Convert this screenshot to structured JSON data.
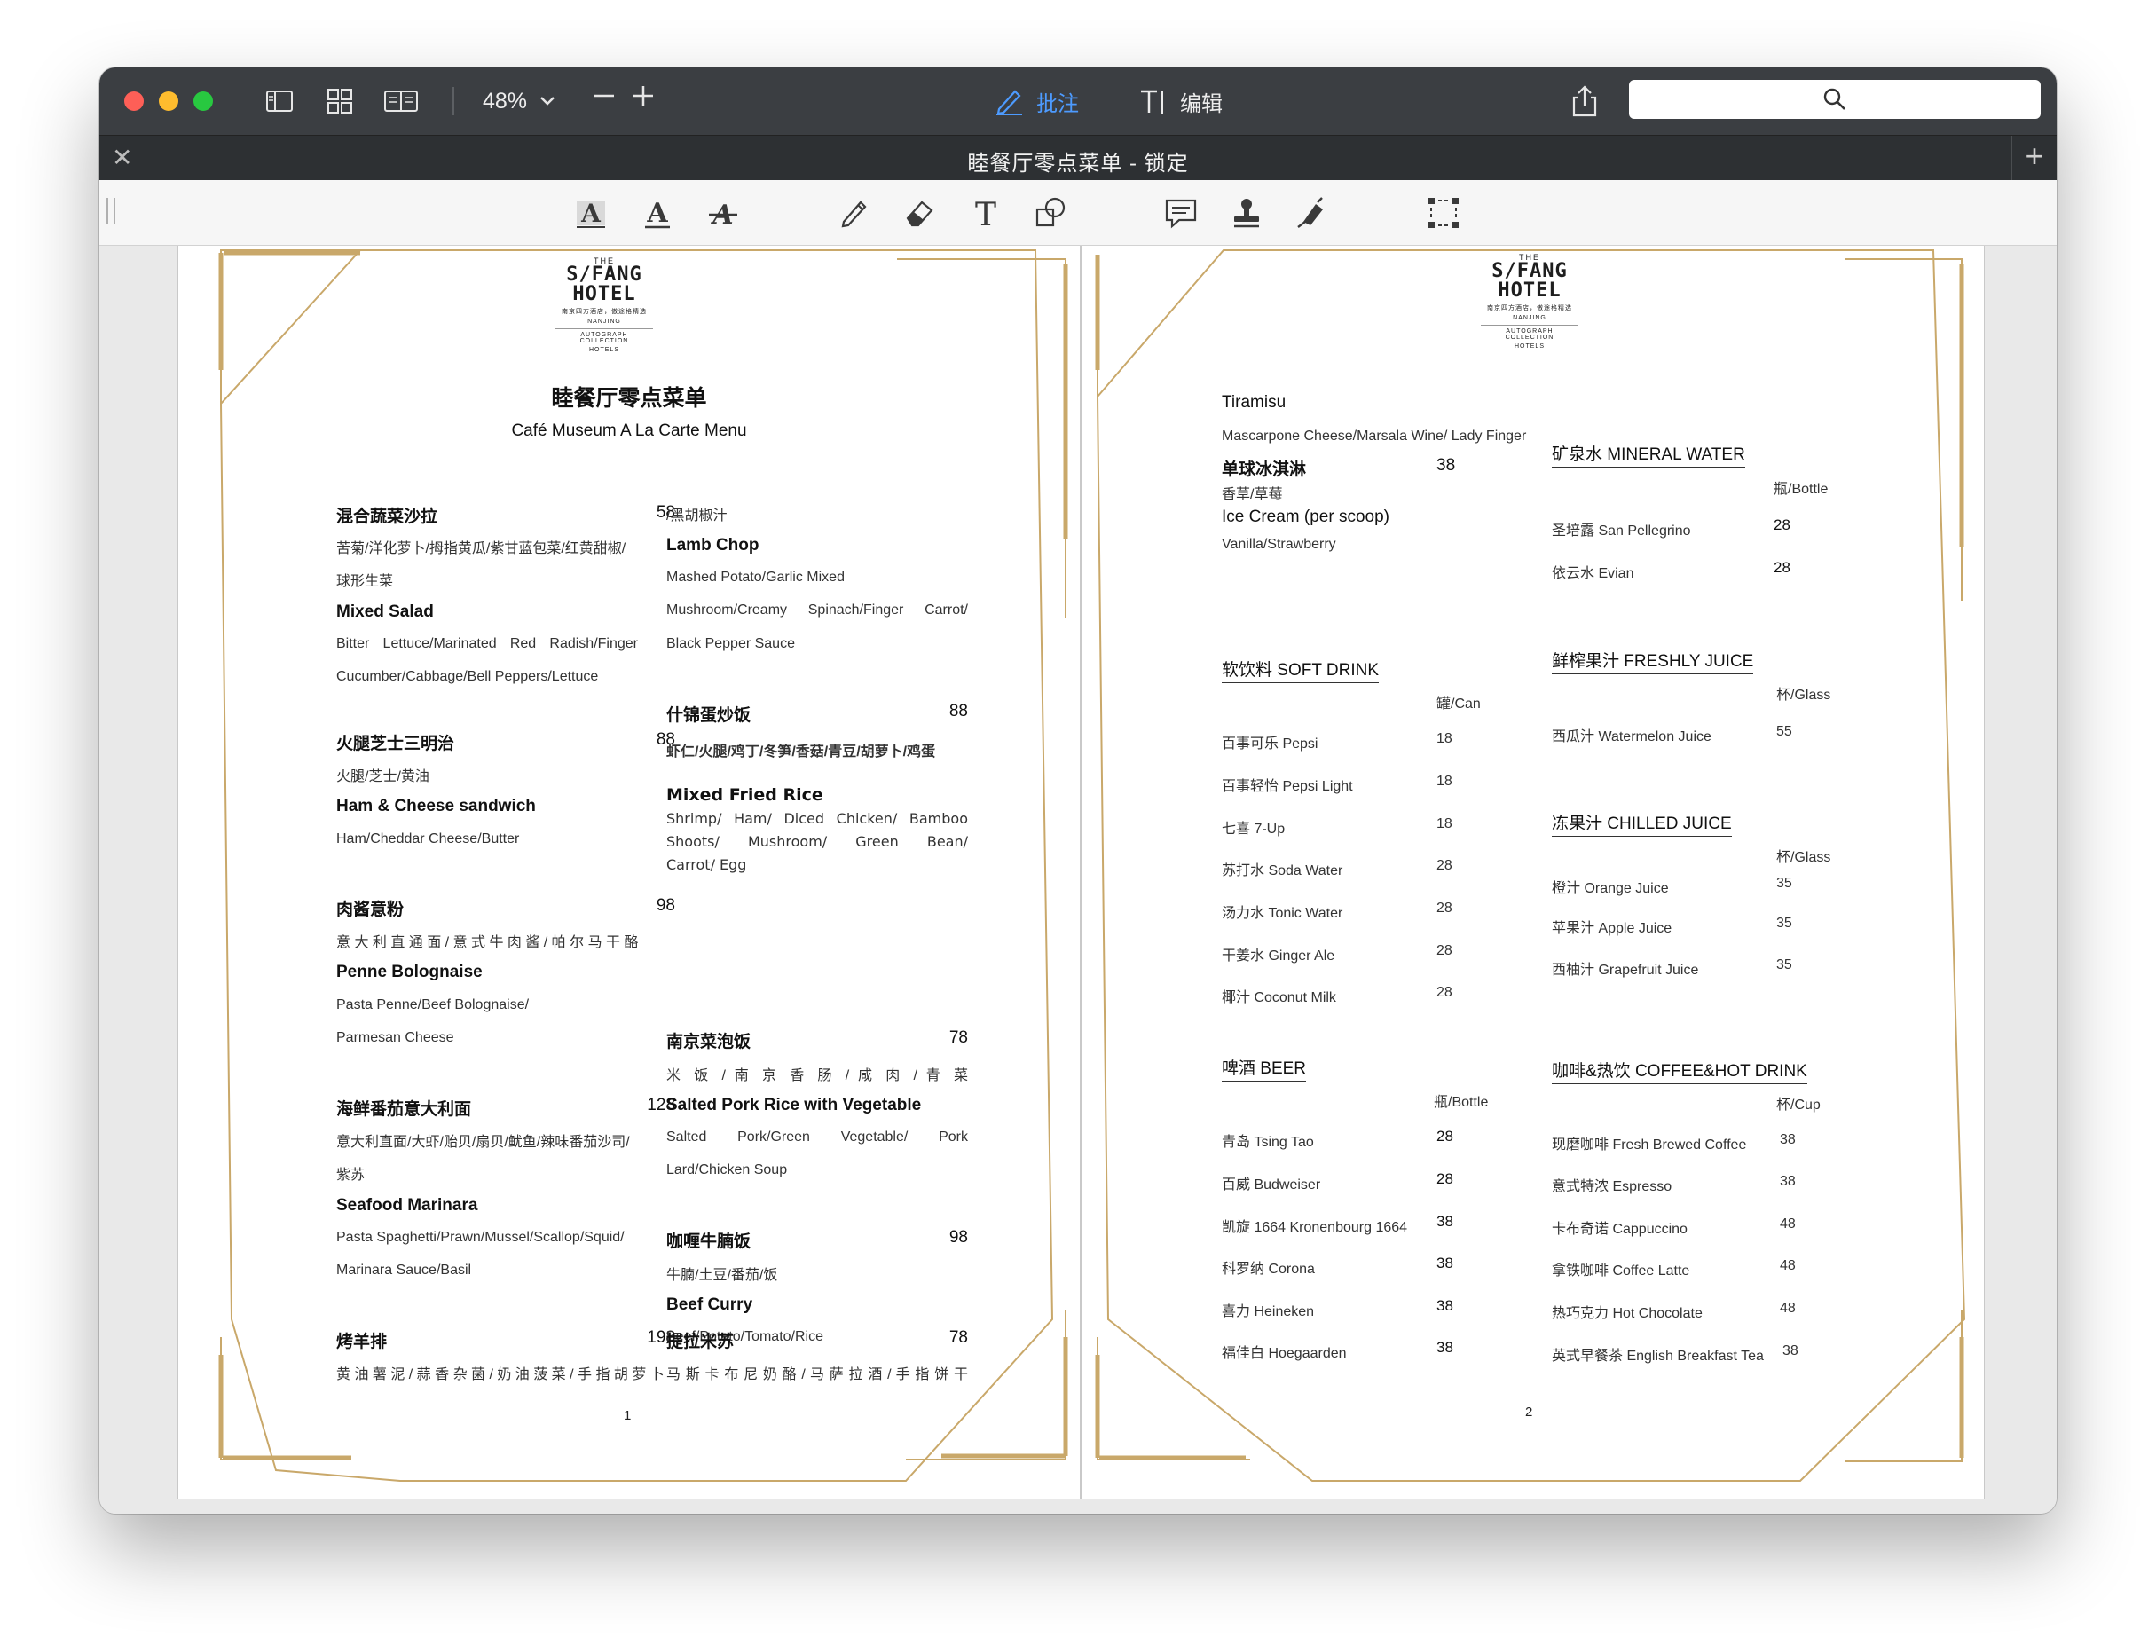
{
  "toolbar": {
    "zoom": "48%",
    "annotate_label": "批注",
    "edit_label": "编辑",
    "search_placeholder": ""
  },
  "tab": {
    "title": "睦餐厅零点菜单 - 锁定"
  },
  "logo": {
    "the": "THE",
    "line1": "S/FANG",
    "line2": "HOTEL",
    "sub1": "南京四方酒店，傲途格精选",
    "sub2": "NANJING",
    "collection": "AUTOGRAPH COLLECTION",
    "hotels": "HOTELS"
  },
  "page1": {
    "title_zh": "睦餐厅零点菜单",
    "title_en": "Café Museum A La Carte Menu",
    "page_num": "1",
    "items": {
      "salad": {
        "zh": "混合蔬菜沙拉",
        "price": "58",
        "desc_zh_1": "苦菊/洋化萝卜/拇指黄瓜/紫甘蓝包菜/红黄甜椒/",
        "desc_zh_2": "球形生菜",
        "en": "Mixed Salad",
        "desc_en_1": "Bitter  Lettuce/Marinated  Red  Radish/Finger",
        "desc_en_2": "Cucumber/Cabbage/Bell Peppers/Lettuce"
      },
      "ham": {
        "zh": "火腿芝士三明治",
        "price": "88",
        "desc_zh": "火腿/芝士/黄油",
        "en": "Ham & Cheese sandwich",
        "desc_en": "Ham/Cheddar Cheese/Butter"
      },
      "penne": {
        "zh": "肉酱意粉",
        "price": "98",
        "desc_zh": "意 大 利 直 通 面 / 意 式 牛 肉 酱 / 帕 尔 马 干 酪",
        "en": "Penne Bolognaise",
        "desc_en_1": "Pasta Penne/Beef Bolognaise/",
        "desc_en_2": "Parmesan Cheese"
      },
      "seafood": {
        "zh": "海鲜番茄意大利面",
        "price": "128",
        "desc_zh_1": "意大利直面/大虾/贻贝/扇贝/鱿鱼/辣味番茄沙司/",
        "desc_zh_2": "紫苏",
        "en": "Seafood Marinara",
        "desc_en_1": "Pasta  Spaghetti/Prawn/Mussel/Scallop/Squid/",
        "desc_en_2": "Marinara Sauce/Basil"
      },
      "lamb_zh": {
        "zh": "烤羊排",
        "price": "198",
        "desc_zh": "黄 油 薯 泥 / 蒜 香 杂 菌 / 奶 油 菠 菜 / 手 指 胡 萝 卜"
      },
      "lamb": {
        "desc_zh_tail": "/黑胡椒汁",
        "en": "Lamb Chop",
        "desc_en_1": "Mashed Potato/Garlic Mixed",
        "desc_en_2": "Mushroom/Creamy   Spinach/Finger   Carrot/",
        "desc_en_3": "Black Pepper Sauce"
      },
      "rice": {
        "zh": "什锦蛋炒饭",
        "price": "88",
        "desc_zh": "虾仁/火腿/鸡丁/冬笋/香菇/青豆/胡萝卜/鸡蛋",
        "en": "Mixed Fried Rice",
        "desc_en_1": "Shrimp/  Ham/  Diced  Chicken/  Bamboo",
        "desc_en_2": "Shoots/   Mushroom/   Green   Bean/",
        "desc_en_3": "Carrot/ Egg"
      },
      "pork": {
        "zh": "南京菜泡饭",
        "price": "78",
        "desc_zh": "米 饭 / 南 京 香 肠 / 咸 肉 / 青 菜",
        "en": "Salted Pork Rice with Vegetable",
        "desc_en_1": "Salted    Pork/Green    Vegetable/    Pork",
        "desc_en_2": "Lard/Chicken Soup"
      },
      "curry": {
        "zh": "咖喱牛腩饭",
        "price": "98",
        "desc_zh": "牛腩/土豆/番茄/饭",
        "en": "Beef Curry",
        "desc_en": "Beef/Potato/Tomato/Rice"
      },
      "tiramisu_zh": {
        "zh": "提拉米苏",
        "price": "78",
        "desc_zh": "马 斯 卡 布 尼 奶 酪 / 马 萨 拉 酒 / 手 指 饼 干"
      }
    }
  },
  "page2": {
    "page_num": "2",
    "tiramisu": {
      "en": "Tiramisu",
      "desc": "Mascarpone Cheese/Marsala Wine/ Lady Finger"
    },
    "icecream": {
      "zh": "单球冰淇淋",
      "price": "38",
      "desc_zh": "香草/草莓",
      "en": "Ice Cream (per scoop)",
      "desc_en": "Vanilla/Strawberry"
    },
    "mineral": {
      "title": "矿泉水  MINERAL WATER",
      "unit": "瓶/Bottle",
      "items": [
        {
          "name": "圣培露  San Pellegrino",
          "price": "28"
        },
        {
          "name": "依云水  Evian",
          "price": "28"
        }
      ]
    },
    "juice": {
      "title": "鲜榨果汁  FRESHLY JUICE",
      "unit": "杯/Glass",
      "items": [
        {
          "name": "西瓜汁  Watermelon Juice",
          "price": "55"
        }
      ]
    },
    "soft": {
      "title": "软饮料  SOFT DRINK",
      "unit": "罐/Can",
      "items": [
        {
          "name": "百事可乐  Pepsi",
          "price": "18"
        },
        {
          "name": "百事轻怡  Pepsi Light",
          "price": "18"
        },
        {
          "name": "七喜  7-Up",
          "price": "18"
        },
        {
          "name": "苏打水  Soda Water",
          "price": "28"
        },
        {
          "name": "汤力水  Tonic Water",
          "price": "28"
        },
        {
          "name": "干姜水  Ginger Ale",
          "price": "28"
        },
        {
          "name": "椰汁  Coconut Milk",
          "price": "28"
        }
      ]
    },
    "chilled": {
      "title": "冻果汁  CHILLED JUICE",
      "unit": "杯/Glass",
      "items": [
        {
          "name": "橙汁  Orange Juice",
          "price": "35"
        },
        {
          "name": "苹果汁  Apple Juice",
          "price": "35"
        },
        {
          "name": "西柚汁  Grapefruit Juice",
          "price": "35"
        }
      ]
    },
    "beer": {
      "title": "啤酒  BEER",
      "unit": "瓶/Bottle",
      "items": [
        {
          "name": "青岛  Tsing Tao",
          "price": "28"
        },
        {
          "name": "百威  Budweiser",
          "price": "28"
        },
        {
          "name": "凯旋  1664 Kronenbourg 1664",
          "price": "38"
        },
        {
          "name": "科罗纳  Corona",
          "price": "38"
        },
        {
          "name": "喜力  Heineken",
          "price": "38"
        },
        {
          "name": "福佳白  Hoegaarden",
          "price": "38"
        }
      ]
    },
    "coffee": {
      "title": "咖啡&热饮  COFFEE&HOT DRINK",
      "unit": "杯/Cup",
      "items": [
        {
          "name": "现磨咖啡  Fresh Brewed Coffee",
          "price": "38"
        },
        {
          "name": "意式特浓  Espresso",
          "price": "38"
        },
        {
          "name": "卡布奇诺  Cappuccino",
          "price": "48"
        },
        {
          "name": "拿铁咖啡  Coffee Latte",
          "price": "48"
        },
        {
          "name": "热巧克力  Hot Chocolate",
          "price": "48"
        },
        {
          "name": "英式早餐茶  English Breakfast Tea",
          "price": "38"
        }
      ]
    }
  },
  "colors": {
    "accent": "#4d9bff",
    "gold": "#c9a86a",
    "titlebar": "#3b3e42"
  }
}
